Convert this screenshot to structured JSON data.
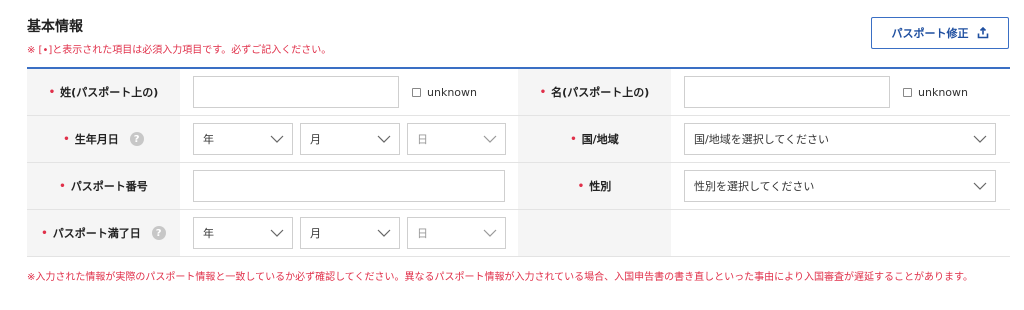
{
  "section": {
    "title": "基本情報",
    "notice": "※ [•]と表示された項目は必須入力項目です。必ずご記入ください。",
    "edit_button_label": "パスポート修正"
  },
  "fields": {
    "required_mark": "•",
    "surname_label": "姓(パスポート上の)",
    "given_name_label": "名(パスポート上の)",
    "unknown_label": "unknown",
    "dob_label": "生年月日",
    "country_label": "国/地域",
    "country_placeholder": "国/地域を選択してください",
    "passport_no_label": "パスポート番号",
    "gender_label": "性別",
    "gender_placeholder": "性別を選択してください",
    "expiry_label": "パスポート満了日",
    "year": "年",
    "month": "月",
    "day": "日",
    "help_glyph": "?"
  },
  "footer": {
    "note": "※入力された情報が実際のパスポート情報と一致しているか必ず確認してください。異なるパスポート情報が入力されている場合、入国申告書の書き直しといった事由により入国審査が遅延することがあります。"
  },
  "colors": {
    "accent": "#3a6fc4",
    "required": "#e0304a",
    "label_bg": "#f5f5f5"
  },
  "icons": {
    "edit_button": "upload-icon",
    "select": "chevron-down-icon",
    "help": "help-circle-icon"
  }
}
